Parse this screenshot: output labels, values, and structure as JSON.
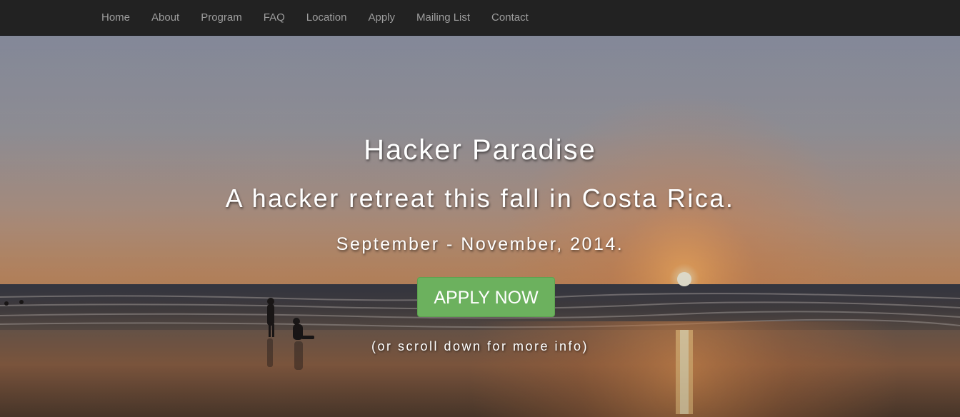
{
  "nav": {
    "items": [
      {
        "label": "Home"
      },
      {
        "label": "About"
      },
      {
        "label": "Program"
      },
      {
        "label": "FAQ"
      },
      {
        "label": "Location"
      },
      {
        "label": "Apply"
      },
      {
        "label": "Mailing List"
      },
      {
        "label": "Contact"
      }
    ]
  },
  "hero": {
    "title": "Hacker Paradise",
    "subtitle": "A hacker retreat this fall in Costa Rica.",
    "dates": "September - November, 2014.",
    "apply_label": "APPLY NOW",
    "scroll_note": "(or scroll down for more info)",
    "background": "sunset-beach-photo"
  },
  "colors": {
    "navbar": "#222222",
    "nav_text": "#9d9d9d",
    "apply_button": "#6cb15e",
    "hero_text": "#ffffff"
  }
}
